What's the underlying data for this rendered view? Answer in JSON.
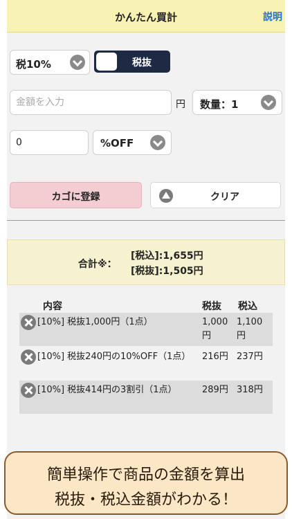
{
  "header": {
    "title": "かんたん買計",
    "help_label": "説明"
  },
  "controls": {
    "tax_rate": "税10%",
    "tax_mode_label": "税抜",
    "amount_placeholder": "金額を入力",
    "yen_unit": "円",
    "quantity": "数量：1",
    "discount_value": "0",
    "discount_type": "%OFF"
  },
  "actions": {
    "register_label": "カゴに登録",
    "clear_label": "クリア"
  },
  "total": {
    "label": "合計※：",
    "tax_included": "[税込]:1,655円",
    "tax_excluded": "[税抜]:1,505円"
  },
  "list": {
    "headers": {
      "content": "内容",
      "tax_excluded": "税抜",
      "tax_included": "税込"
    },
    "items": [
      {
        "name": "[10%] 税抜1,000円（1点）",
        "tax_excluded": "1,000 円",
        "tax_included": "1,100 円"
      },
      {
        "name": "[10%] 税抜240円の10%OFF（1点）",
        "tax_excluded": "216円",
        "tax_included": "237円"
      },
      {
        "name": "[10%] 税抜414円の3割引（1点）",
        "tax_excluded": "289円",
        "tax_included": "318円"
      }
    ]
  },
  "banner": {
    "line1": "簡単操作で商品の金額を算出",
    "line2": "税抜・税込金額がわかる！"
  },
  "icons": [
    "chevron-down-icon",
    "warning-icon",
    "delete-icon"
  ],
  "colors": {
    "header_bg": "#f8f3b3",
    "toggle_bg": "#1e2a44",
    "register_bg": "#f3cdd2",
    "help_link": "#1f6fd6",
    "banner_border": "#8a5a2a"
  }
}
